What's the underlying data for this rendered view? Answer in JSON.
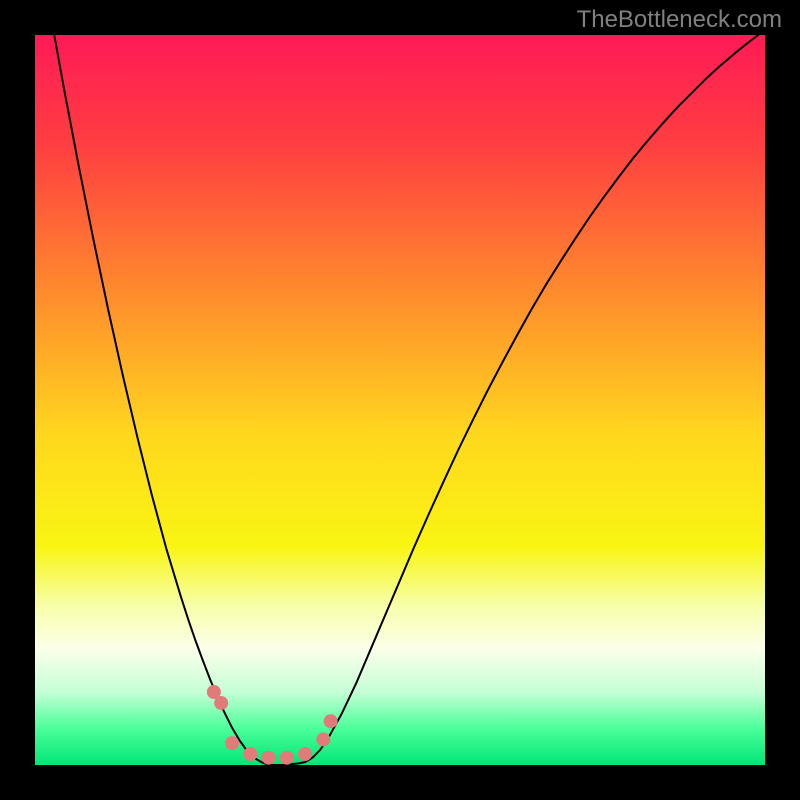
{
  "watermark": "TheBottleneck.com",
  "chart_data": {
    "type": "line",
    "title": "",
    "xlabel": "",
    "ylabel": "",
    "xlim": [
      0,
      1
    ],
    "ylim": [
      0,
      1
    ],
    "background_gradient": {
      "stops": [
        {
          "offset": 0.0,
          "color": "#ff1a56"
        },
        {
          "offset": 0.15,
          "color": "#ff3e41"
        },
        {
          "offset": 0.35,
          "color": "#ff8a2d"
        },
        {
          "offset": 0.55,
          "color": "#ffd81e"
        },
        {
          "offset": 0.7,
          "color": "#f9f512"
        },
        {
          "offset": 0.78,
          "color": "#f7ffa7"
        },
        {
          "offset": 0.84,
          "color": "#fcffe9"
        },
        {
          "offset": 0.9,
          "color": "#c5ffd6"
        },
        {
          "offset": 0.95,
          "color": "#4bff99"
        },
        {
          "offset": 1.0,
          "color": "#00e676"
        }
      ]
    },
    "series": [
      {
        "name": "main-curve",
        "color": "#000000",
        "width": 2,
        "x": [
          0.0,
          0.02,
          0.04,
          0.06,
          0.08,
          0.1,
          0.12,
          0.14,
          0.16,
          0.18,
          0.2,
          0.21,
          0.22,
          0.23,
          0.24,
          0.25,
          0.26,
          0.27,
          0.28,
          0.29,
          0.3,
          0.31,
          0.32,
          0.33,
          0.34,
          0.35,
          0.36,
          0.37,
          0.38,
          0.39,
          0.4,
          0.42,
          0.44,
          0.46,
          0.48,
          0.5,
          0.52,
          0.54,
          0.56,
          0.58,
          0.6,
          0.62,
          0.64,
          0.66,
          0.68,
          0.7,
          0.72,
          0.74,
          0.76,
          0.78,
          0.8,
          0.82,
          0.84,
          0.86,
          0.88,
          0.9,
          0.92,
          0.94,
          0.96,
          0.98,
          1.0
        ],
        "y": [
          1.15,
          1.035,
          0.925,
          0.82,
          0.72,
          0.625,
          0.535,
          0.45,
          0.37,
          0.296,
          0.23,
          0.199,
          0.17,
          0.143,
          0.117,
          0.093,
          0.071,
          0.051,
          0.034,
          0.02,
          0.01,
          0.004,
          0.0,
          0.0,
          0.0,
          0.001,
          0.002,
          0.004,
          0.01,
          0.02,
          0.034,
          0.07,
          0.112,
          0.159,
          0.206,
          0.253,
          0.3,
          0.345,
          0.389,
          0.432,
          0.473,
          0.513,
          0.551,
          0.588,
          0.624,
          0.658,
          0.69,
          0.721,
          0.751,
          0.779,
          0.806,
          0.832,
          0.856,
          0.879,
          0.901,
          0.921,
          0.941,
          0.959,
          0.976,
          0.992,
          1.007
        ]
      },
      {
        "name": "marker-band",
        "color": "#e27a7a",
        "type": "scatter",
        "marker_size": 14,
        "x": [
          0.245,
          0.255,
          0.27,
          0.295,
          0.32,
          0.345,
          0.37,
          0.395,
          0.405
        ],
        "y": [
          0.1,
          0.085,
          0.03,
          0.015,
          0.01,
          0.01,
          0.015,
          0.035,
          0.06
        ]
      }
    ]
  }
}
